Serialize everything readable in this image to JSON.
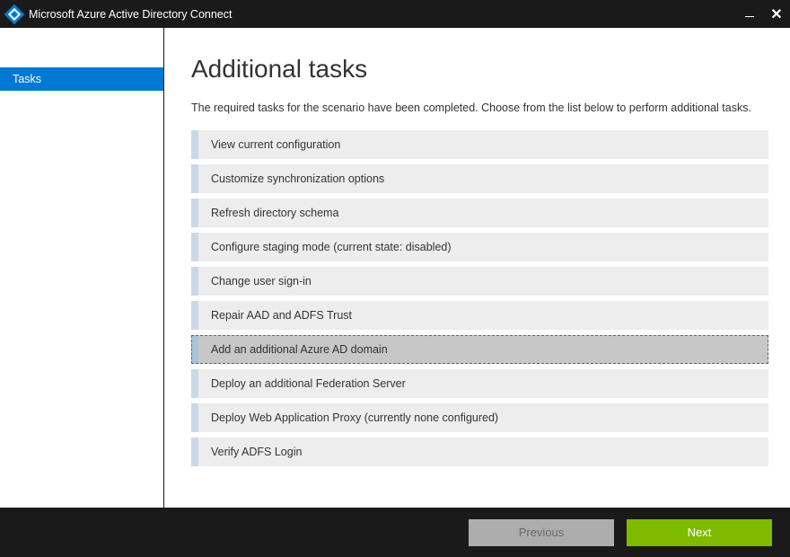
{
  "titlebar": {
    "title": "Microsoft Azure Active Directory Connect"
  },
  "sidebar": {
    "items": [
      {
        "label": "Tasks",
        "active": true
      }
    ]
  },
  "main": {
    "title": "Additional tasks",
    "description": "The required tasks for the scenario have been completed. Choose from the list below to perform additional tasks.",
    "tasks": [
      {
        "label": "View current configuration",
        "selected": false
      },
      {
        "label": "Customize synchronization options",
        "selected": false
      },
      {
        "label": "Refresh directory schema",
        "selected": false
      },
      {
        "label": "Configure staging mode (current state: disabled)",
        "selected": false
      },
      {
        "label": "Change user sign-in",
        "selected": false
      },
      {
        "label": "Repair AAD and ADFS Trust",
        "selected": false
      },
      {
        "label": "Add an additional Azure AD domain",
        "selected": true
      },
      {
        "label": "Deploy an additional Federation Server",
        "selected": false
      },
      {
        "label": "Deploy Web Application Proxy (currently none configured)",
        "selected": false
      },
      {
        "label": "Verify ADFS Login",
        "selected": false
      }
    ]
  },
  "footer": {
    "previous_label": "Previous",
    "next_label": "Next"
  }
}
